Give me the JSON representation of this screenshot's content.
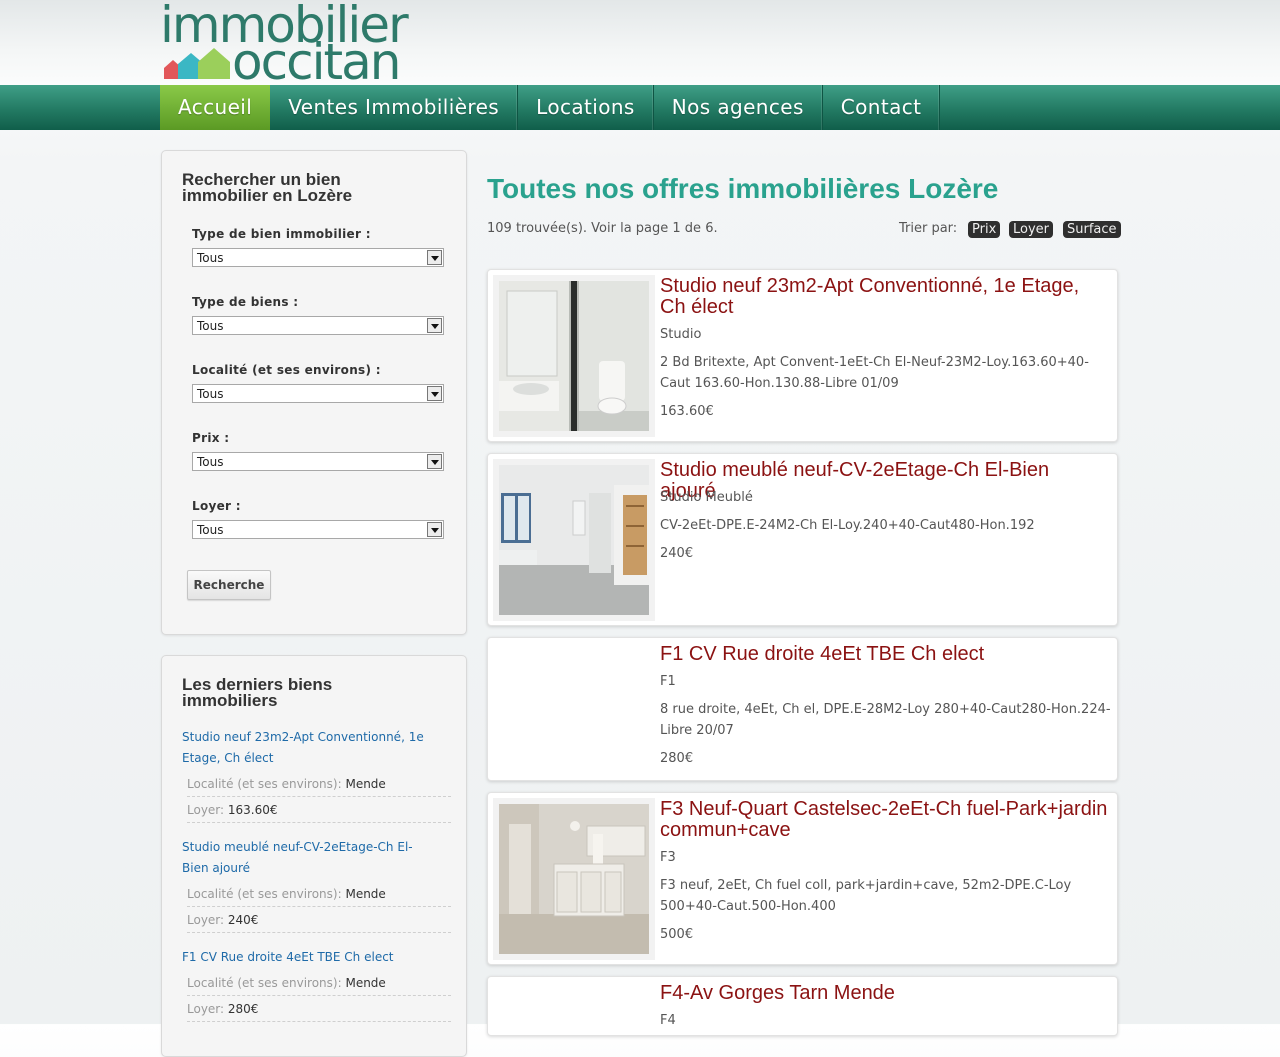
{
  "brand": {
    "line1": "immobilier",
    "line2": "occitan",
    "color_text": "#2e7a6a",
    "colors_houses": [
      "#e2575a",
      "#3bb7c4",
      "#9bcf5b"
    ]
  },
  "nav": {
    "items": [
      {
        "label": "Accueil",
        "active": true
      },
      {
        "label": "Ventes Immobilières",
        "active": false
      },
      {
        "label": "Locations",
        "active": false
      },
      {
        "label": "Nos agences",
        "active": false
      },
      {
        "label": "Contact",
        "active": false
      }
    ]
  },
  "search": {
    "title": "Rechercher un bien immobilier en Lozère",
    "fields": [
      {
        "label": "Type de bien immobilier :",
        "value": "Tous"
      },
      {
        "label": "Type de biens :",
        "value": "Tous"
      },
      {
        "label": "Localité (et ses environs) :",
        "value": "Tous"
      },
      {
        "label": "Prix :",
        "value": "Tous"
      },
      {
        "label": "Loyer :",
        "value": "Tous"
      }
    ],
    "button": "Recherche"
  },
  "latest": {
    "title": "Les derniers biens immobiliers",
    "items": [
      {
        "title": "Studio neuf 23m2-Apt Conventionné, 1e Etage, Ch élect",
        "loc_label": "Localité (et ses environs):",
        "loc_value": "Mende",
        "rent_label": "Loyer:",
        "rent_value": "163.60€"
      },
      {
        "title": "Studio meublé neuf-CV-2eEtage-Ch El-Bien ajouré",
        "loc_label": "Localité (et ses environs):",
        "loc_value": "Mende",
        "rent_label": "Loyer:",
        "rent_value": "240€"
      },
      {
        "title": "F1 CV Rue droite 4eEt TBE Ch elect",
        "loc_label": "Localité (et ses environs):",
        "loc_value": "Mende",
        "rent_label": "Loyer:",
        "rent_value": "280€"
      }
    ]
  },
  "main": {
    "title": "Toutes nos offres immobilières Lozère",
    "count": "109 trouvée(s). Voir la page 1 de 6.",
    "sort_label": "Trier par:",
    "sort_options": [
      "Prix",
      "Loyer",
      "Surface"
    ]
  },
  "listings": [
    {
      "title": "Studio neuf 23m2-Apt Conventionné, 1e Etage, Ch élect",
      "type": "Studio",
      "desc": "2 Bd Britexte, Apt Convent-1eEt-Ch El-Neuf-23M2-Loy.163.60+40-Caut 163.60-Hon.130.88-Libre 01/09",
      "price": "163.60€",
      "photo": "bathroom"
    },
    {
      "title": "Studio meublé neuf-CV-2eEtage-Ch El-Bien ajouré",
      "type": "Studio Meublé",
      "desc": "CV-2eEt-DPE.E-24M2-Ch El-Loy.240+40-Caut480-Hon.192",
      "price": "240€",
      "photo": "room"
    },
    {
      "title": "F1 CV Rue droite 4eEt TBE Ch elect",
      "type": "F1",
      "desc": "8 rue droite, 4eEt, Ch el, DPE.E-28M2-Loy 280+40-Caut280-Hon.224-Libre 20/07",
      "price": "280€",
      "photo": "none"
    },
    {
      "title": "F3 Neuf-Quart Castelsec-2eEt-Ch fuel-Park+jardin commun+cave",
      "type": "F3",
      "desc": "F3 neuf, 2eEt, Ch fuel coll, park+jardin+cave, 52m2-DPE.C-Loy 500+40-Caut.500-Hon.400",
      "price": "500€",
      "photo": "kitchen"
    },
    {
      "title": "F4-Av Gorges Tarn Mende",
      "type": "F4",
      "desc": "",
      "price": "",
      "photo": "none"
    }
  ]
}
